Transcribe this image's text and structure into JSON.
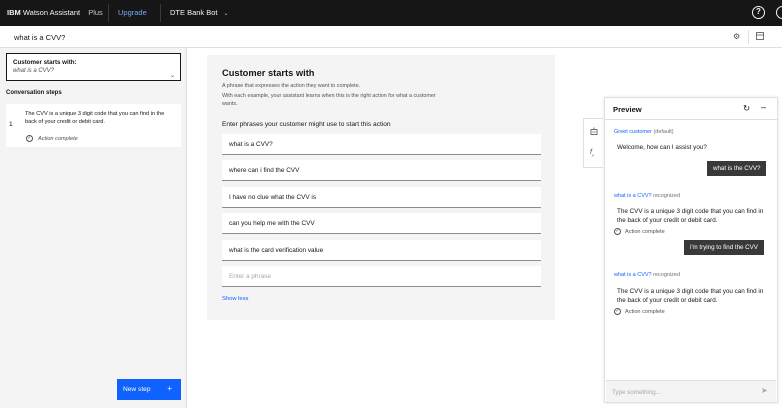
{
  "topbar": {
    "brand": "IBM",
    "product": "Watson Assistant",
    "plan": "Plus",
    "upgrade": "Upgrade",
    "assistant_name": "DTE Bank Bot",
    "help_icon": "help-icon",
    "user_icon": "user-icon"
  },
  "action": {
    "title": "what is a CVV?"
  },
  "left_panel": {
    "starts_with_title": "Customer starts with:",
    "starts_with_value": "what is a CVV?",
    "conversation_steps_label": "Conversation steps",
    "steps": [
      {
        "number": "1",
        "text": "The CVV is a unique 3 digit code that you can find in the back of your credit or debit card.",
        "status": "Action complete"
      }
    ],
    "new_step_label": "New step",
    "new_step_icon": "+"
  },
  "customer_starts": {
    "heading": "Customer starts with",
    "description": "A phrase that expresses the action they want to complete.",
    "description2": "With each example, your assistant learns when this is the right action for what a customer wants.",
    "enter_label": "Enter phrases your customer might use to start this action",
    "phrases": [
      "what is a CVV?",
      "where can i find the CVV",
      "I have no clue what the CVV is",
      "can you help me with the CVV",
      "what is the card verification value"
    ],
    "phrase_placeholder": "Enter a phrase",
    "show_less": "Show less"
  },
  "preview": {
    "title": "Preview",
    "greet_link": "Greet customer",
    "greet_meta": "(default)",
    "welcome": "Welcome, how can I assist you?",
    "user_msg_1": "what is the CVV?",
    "recognized_link_1": "what is a CVV?",
    "recognized_meta_1": "recognized",
    "bot_reply_1": "The CVV is a unique 3 digit code that you can find in the back of your credit or debit card.",
    "status_1": "Action complete",
    "user_msg_2": "i'm trying to find the CVV",
    "recognized_link_2": "what is a CVV?",
    "recognized_meta_2": "recognized",
    "bot_reply_2": "The CVV is a unique 3 digit code that you can find in the back of your credit or debit card.",
    "status_2": "Action complete",
    "input_placeholder": "Type something..."
  },
  "colors": {
    "topbar_bg": "#161616",
    "accent": "#0f62fe",
    "link": "#78a9ff",
    "user_bubble": "#393939",
    "panel_bg": "#f4f4f4"
  }
}
